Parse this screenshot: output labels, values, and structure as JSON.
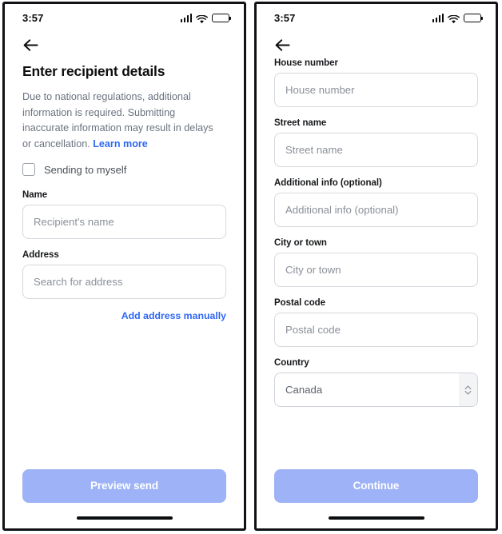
{
  "accent": {
    "link_blue": "#2f67f4",
    "cta_blue": "#9db2f7",
    "text_dark": "#0e0f11",
    "text_muted": "#6b7280",
    "placeholder": "#8b9099",
    "border": "#d5d8dd"
  },
  "screens": [
    {
      "id": "recipient-details",
      "statusbar": {
        "time": "3:57",
        "cellular_icon": "cellular-signal-icon",
        "wifi_icon": "wifi-icon",
        "battery_icon": "battery-icon"
      },
      "nav": {
        "back_icon": "back-arrow-icon"
      },
      "title": "Enter recipient details",
      "intro": {
        "text": "Due to national regulations, additional information is required. Submitting inaccurate information may result in delays or cancellation. ",
        "link_label": "Learn more"
      },
      "checkbox": {
        "label": "Sending to myself",
        "checked": false
      },
      "fields": [
        {
          "label": "Name",
          "placeholder": "Recipient's name",
          "value": "",
          "type": "text",
          "name": "name"
        },
        {
          "label": "Address",
          "placeholder": "Search for address",
          "value": "",
          "type": "text",
          "name": "address"
        }
      ],
      "secondary_link": "Add address manually",
      "cta_label": "Preview send"
    },
    {
      "id": "address-details",
      "statusbar": {
        "time": "3:57",
        "cellular_icon": "cellular-signal-icon",
        "wifi_icon": "wifi-icon",
        "battery_icon": "battery-icon"
      },
      "nav": {
        "back_icon": "back-arrow-icon"
      },
      "fields": [
        {
          "label": "House number",
          "placeholder": "House number",
          "value": "",
          "type": "text",
          "name": "house-number"
        },
        {
          "label": "Street name",
          "placeholder": "Street name",
          "value": "",
          "type": "text",
          "name": "street-name"
        },
        {
          "label": "Additional info (optional)",
          "placeholder": "Additional info (optional)",
          "value": "",
          "type": "text",
          "name": "additional-info"
        },
        {
          "label": "City or town",
          "placeholder": "City or town",
          "value": "",
          "type": "text",
          "name": "city-or-town"
        },
        {
          "label": "Postal code",
          "placeholder": "Postal code",
          "value": "",
          "type": "text",
          "name": "postal-code"
        }
      ],
      "country_field": {
        "label": "Country",
        "selected": "Canada",
        "stepper_icon": "chevron-up-down-icon"
      },
      "cta_label": "Continue"
    }
  ]
}
